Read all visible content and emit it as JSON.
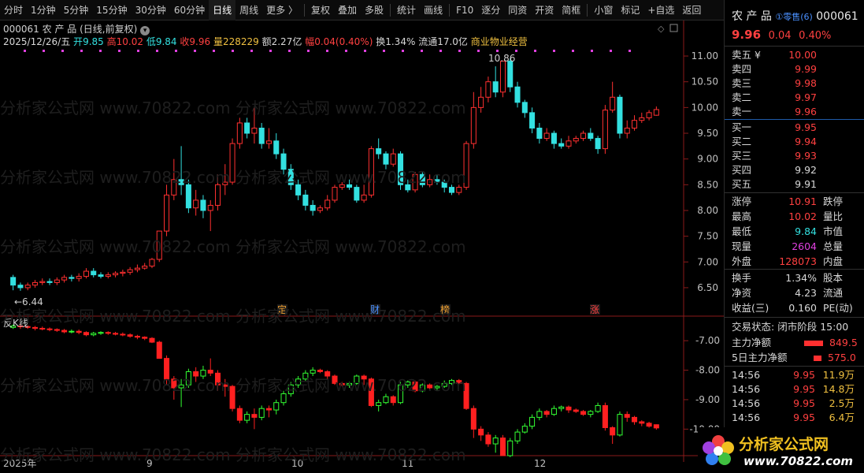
{
  "toolbar": {
    "items": [
      "分时",
      "1分钟",
      "5分钟",
      "15分钟",
      "30分钟",
      "60分钟",
      "日线",
      "周线",
      "更多 〉",
      "复权",
      "叠加",
      "多股",
      "统计",
      "画线",
      "F10",
      "逐分",
      "同资",
      "开资",
      "简框",
      "小窗",
      "标记",
      "+自选",
      "返回"
    ],
    "active": "日线"
  },
  "stock": {
    "code": "000061",
    "name": "农 产 品",
    "mode": "(日线,前复权)",
    "date": "2025/12/26/五",
    "open_label": "开",
    "open": "9.85",
    "high_label": "高",
    "high": "10.02",
    "low_label": "低",
    "low": "9.84",
    "close_label": "收",
    "close": "9.96",
    "vol_label": "量",
    "vol": "228229",
    "amt_label": "额",
    "amt": "2.27亿",
    "amp_label": "幅",
    "amp": "0.04(0.40%)",
    "turn_label": "换",
    "turn": "1.34%",
    "float_label": "流通",
    "float": "17.0亿",
    "sector": "商业物业经营",
    "price_max": "10.86",
    "price_min": "6.44"
  },
  "indicator": {
    "name": "反K线"
  },
  "markers": [
    {
      "text": "定",
      "color": "#f0a030"
    },
    {
      "text": "财",
      "color": "#4a90ff"
    },
    {
      "text": "榜",
      "color": "#f0a030"
    },
    {
      "text": "涨",
      "color": "#ff4040"
    }
  ],
  "chart_data": {
    "type": "candlestick",
    "yticks": [
      "11.00",
      "10.50",
      "10.00",
      "9.50",
      "9.00",
      "8.50",
      "8.00",
      "7.50",
      "7.00",
      "6.50"
    ],
    "ylim": [
      6.3,
      11.2
    ],
    "xlabels": [
      "2025年",
      "9",
      "10",
      "11",
      "12"
    ],
    "indicator_yticks": [
      "-7.00",
      "-8.00",
      "-9.00",
      "-10.00"
    ],
    "indicator_ylim": [
      -10.9,
      -6.3
    ],
    "candles": [
      [
        6.7,
        6.55,
        6.75,
        6.45
      ],
      [
        6.55,
        6.5,
        6.6,
        6.44
      ],
      [
        6.5,
        6.55,
        6.6,
        6.45
      ],
      [
        6.55,
        6.6,
        6.65,
        6.5
      ],
      [
        6.6,
        6.62,
        6.68,
        6.55
      ],
      [
        6.62,
        6.6,
        6.68,
        6.55
      ],
      [
        6.6,
        6.65,
        6.7,
        6.55
      ],
      [
        6.65,
        6.7,
        6.75,
        6.6
      ],
      [
        6.7,
        6.68,
        6.75,
        6.62
      ],
      [
        6.68,
        6.72,
        6.78,
        6.62
      ],
      [
        6.72,
        6.82,
        6.88,
        6.68
      ],
      [
        6.82,
        6.75,
        6.88,
        6.7
      ],
      [
        6.75,
        6.72,
        6.8,
        6.68
      ],
      [
        6.72,
        6.75,
        6.8,
        6.68
      ],
      [
        6.75,
        6.78,
        6.82,
        6.7
      ],
      [
        6.78,
        6.8,
        6.85,
        6.72
      ],
      [
        6.8,
        6.85,
        6.9,
        6.75
      ],
      [
        6.85,
        6.88,
        6.95,
        6.8
      ],
      [
        6.88,
        6.92,
        6.98,
        6.85
      ],
      [
        6.92,
        7.05,
        7.08,
        6.88
      ],
      [
        7.05,
        7.6,
        7.6,
        7.0
      ],
      [
        7.6,
        8.3,
        8.5,
        7.5
      ],
      [
        8.3,
        8.6,
        9.0,
        8.2
      ],
      [
        8.6,
        8.5,
        9.25,
        8.3
      ],
      [
        8.5,
        8.05,
        8.6,
        7.95
      ],
      [
        8.05,
        8.2,
        8.4,
        7.9
      ],
      [
        8.2,
        8.0,
        8.3,
        7.85
      ],
      [
        8.0,
        8.1,
        8.2,
        7.6
      ],
      [
        8.1,
        8.5,
        8.7,
        8.0
      ],
      [
        8.5,
        8.55,
        8.9,
        8.3
      ],
      [
        8.55,
        9.3,
        9.4,
        8.5
      ],
      [
        9.3,
        9.7,
        9.8,
        9.2
      ],
      [
        9.7,
        9.5,
        9.8,
        9.4
      ],
      [
        9.5,
        9.6,
        10.0,
        9.3
      ],
      [
        9.6,
        9.3,
        9.7,
        9.2
      ],
      [
        9.3,
        9.35,
        9.6,
        9.2
      ],
      [
        9.35,
        9.1,
        9.5,
        9.0
      ],
      [
        9.1,
        8.8,
        9.2,
        8.7
      ],
      [
        8.8,
        8.5,
        8.9,
        8.4
      ],
      [
        8.5,
        8.3,
        8.6,
        8.2
      ],
      [
        8.3,
        8.1,
        8.4,
        8.0
      ],
      [
        8.1,
        8.0,
        8.2,
        7.9
      ],
      [
        8.0,
        8.05,
        8.1,
        7.95
      ],
      [
        8.05,
        8.2,
        8.3,
        8.0
      ],
      [
        8.2,
        8.45,
        8.5,
        8.15
      ],
      [
        8.45,
        8.5,
        8.55,
        8.4
      ],
      [
        8.5,
        8.45,
        8.6,
        8.4
      ],
      [
        8.45,
        8.2,
        8.5,
        8.15
      ],
      [
        8.2,
        8.3,
        8.5,
        8.15
      ],
      [
        8.3,
        9.2,
        9.25,
        8.25
      ],
      [
        9.2,
        9.1,
        9.4,
        9.0
      ],
      [
        9.1,
        8.9,
        9.15,
        8.8
      ],
      [
        8.9,
        9.1,
        9.2,
        8.85
      ],
      [
        9.1,
        8.5,
        9.15,
        8.4
      ],
      [
        8.5,
        8.4,
        8.6,
        8.35
      ],
      [
        8.4,
        8.7,
        8.75,
        8.35
      ],
      [
        8.7,
        8.5,
        8.75,
        8.45
      ],
      [
        8.5,
        8.6,
        8.7,
        8.45
      ],
      [
        8.6,
        8.55,
        8.7,
        8.5
      ],
      [
        8.55,
        8.45,
        8.6,
        8.35
      ],
      [
        8.45,
        8.35,
        8.5,
        8.3
      ],
      [
        8.35,
        8.45,
        8.5,
        8.3
      ],
      [
        8.45,
        9.3,
        9.35,
        8.4
      ],
      [
        9.3,
        10.0,
        10.3,
        9.2
      ],
      [
        10.0,
        10.2,
        10.4,
        9.9
      ],
      [
        10.2,
        10.5,
        10.6,
        10.1
      ],
      [
        10.5,
        10.3,
        10.8,
        10.2
      ],
      [
        10.3,
        10.9,
        10.9,
        10.2
      ],
      [
        10.9,
        10.4,
        10.95,
        10.3
      ],
      [
        10.4,
        10.1,
        10.5,
        10.0
      ],
      [
        10.1,
        9.9,
        10.15,
        9.8
      ],
      [
        9.9,
        9.6,
        10.0,
        9.5
      ],
      [
        9.6,
        9.4,
        9.7,
        9.3
      ],
      [
        9.4,
        9.5,
        9.6,
        9.35
      ],
      [
        9.5,
        9.3,
        9.55,
        9.2
      ],
      [
        9.3,
        9.25,
        9.4,
        9.2
      ],
      [
        9.25,
        9.35,
        9.45,
        9.2
      ],
      [
        9.35,
        9.4,
        9.45,
        9.3
      ],
      [
        9.4,
        9.5,
        9.55,
        9.35
      ],
      [
        9.5,
        9.4,
        9.6,
        9.35
      ],
      [
        9.4,
        9.2,
        9.45,
        9.1
      ],
      [
        9.2,
        9.95,
        10.05,
        9.1
      ],
      [
        9.95,
        10.2,
        10.5,
        9.9
      ],
      [
        10.2,
        9.5,
        10.25,
        9.4
      ],
      [
        9.5,
        9.6,
        9.75,
        9.4
      ],
      [
        9.6,
        9.75,
        9.85,
        9.55
      ],
      [
        9.75,
        9.8,
        9.9,
        9.7
      ],
      [
        9.8,
        9.9,
        9.95,
        9.75
      ],
      [
        9.85,
        9.96,
        10.02,
        9.84
      ]
    ],
    "ind": [
      [
        -6.55,
        -6.5,
        -6.45,
        -6.6
      ],
      [
        -6.5,
        -6.52,
        -6.45,
        -6.6
      ],
      [
        -6.52,
        -6.55,
        -6.48,
        -6.6
      ],
      [
        -6.55,
        -6.58,
        -6.5,
        -6.65
      ],
      [
        -6.58,
        -6.6,
        -6.52,
        -6.65
      ],
      [
        -6.6,
        -6.62,
        -6.55,
        -6.68
      ],
      [
        -6.62,
        -6.65,
        -6.58,
        -6.7
      ],
      [
        -6.65,
        -6.7,
        -6.6,
        -6.75
      ],
      [
        -6.7,
        -6.68,
        -6.62,
        -6.75
      ],
      [
        -6.68,
        -6.72,
        -6.62,
        -6.78
      ],
      [
        -6.72,
        -6.8,
        -6.68,
        -6.85
      ],
      [
        -6.8,
        -6.75,
        -6.7,
        -6.85
      ],
      [
        -6.75,
        -6.72,
        -6.68,
        -6.8
      ],
      [
        -6.72,
        -6.75,
        -6.68,
        -6.8
      ],
      [
        -6.75,
        -6.78,
        -6.7,
        -6.82
      ],
      [
        -6.78,
        -6.8,
        -6.72,
        -6.85
      ],
      [
        -6.8,
        -6.85,
        -6.75,
        -6.9
      ],
      [
        -6.85,
        -6.88,
        -6.8,
        -6.95
      ],
      [
        -6.88,
        -6.92,
        -6.85,
        -6.98
      ],
      [
        -6.92,
        -7.05,
        -6.88,
        -7.08
      ],
      [
        -7.05,
        -7.6,
        -7.0,
        -7.6
      ],
      [
        -7.6,
        -8.3,
        -7.5,
        -8.5
      ],
      [
        -8.3,
        -8.6,
        -8.2,
        -9.0
      ],
      [
        -8.6,
        -8.5,
        -8.3,
        -9.25
      ],
      [
        -8.5,
        -8.05,
        -7.95,
        -8.6
      ],
      [
        -8.05,
        -8.2,
        -7.9,
        -8.4
      ],
      [
        -8.2,
        -8.0,
        -7.85,
        -8.3
      ],
      [
        -8.0,
        -8.1,
        -7.6,
        -8.2
      ],
      [
        -8.1,
        -8.5,
        -8.0,
        -8.7
      ],
      [
        -8.5,
        -8.55,
        -8.3,
        -8.9
      ],
      [
        -8.55,
        -9.3,
        -8.5,
        -9.4
      ],
      [
        -9.3,
        -9.7,
        -9.2,
        -9.8
      ],
      [
        -9.7,
        -9.5,
        -9.4,
        -9.8
      ],
      [
        -9.5,
        -9.6,
        -9.3,
        -10.0
      ],
      [
        -9.6,
        -9.3,
        -9.2,
        -9.7
      ],
      [
        -9.3,
        -9.35,
        -9.2,
        -9.6
      ],
      [
        -9.35,
        -9.1,
        -9.0,
        -9.5
      ],
      [
        -9.1,
        -8.8,
        -8.7,
        -9.2
      ],
      [
        -8.8,
        -8.5,
        -8.4,
        -8.9
      ],
      [
        -8.5,
        -8.3,
        -8.2,
        -8.6
      ],
      [
        -8.3,
        -8.1,
        -8.0,
        -8.4
      ],
      [
        -8.1,
        -8.0,
        -7.9,
        -8.2
      ],
      [
        -8.0,
        -8.05,
        -7.95,
        -8.1
      ],
      [
        -8.05,
        -8.2,
        -8.0,
        -8.3
      ],
      [
        -8.2,
        -8.45,
        -8.15,
        -8.5
      ],
      [
        -8.45,
        -8.5,
        -8.4,
        -8.55
      ],
      [
        -8.5,
        -8.45,
        -8.4,
        -8.6
      ],
      [
        -8.45,
        -8.2,
        -8.15,
        -8.5
      ],
      [
        -8.2,
        -8.3,
        -8.15,
        -8.5
      ],
      [
        -8.3,
        -9.2,
        -8.25,
        -9.25
      ],
      [
        -9.2,
        -9.1,
        -9.0,
        -9.4
      ],
      [
        -9.1,
        -8.9,
        -8.8,
        -9.15
      ],
      [
        -8.9,
        -9.1,
        -8.85,
        -9.2
      ],
      [
        -9.1,
        -8.5,
        -8.4,
        -9.15
      ],
      [
        -8.5,
        -8.4,
        -8.35,
        -8.6
      ],
      [
        -8.4,
        -8.7,
        -8.35,
        -8.75
      ],
      [
        -8.7,
        -8.5,
        -8.45,
        -8.75
      ],
      [
        -8.5,
        -8.6,
        -8.45,
        -8.7
      ],
      [
        -8.6,
        -8.55,
        -8.5,
        -8.7
      ],
      [
        -8.55,
        -8.45,
        -8.35,
        -8.6
      ],
      [
        -8.45,
        -8.35,
        -8.3,
        -8.5
      ],
      [
        -8.35,
        -8.45,
        -8.3,
        -8.5
      ],
      [
        -8.45,
        -9.3,
        -8.4,
        -9.35
      ],
      [
        -9.3,
        -10.0,
        -9.2,
        -10.3
      ],
      [
        -10.0,
        -10.2,
        -9.9,
        -10.4
      ],
      [
        -10.2,
        -10.5,
        -10.1,
        -10.6
      ],
      [
        -10.5,
        -10.3,
        -10.2,
        -10.8
      ],
      [
        -10.3,
        -10.9,
        -10.2,
        -10.9
      ],
      [
        -10.9,
        -10.4,
        -10.3,
        -10.95
      ],
      [
        -10.4,
        -10.1,
        -10.0,
        -10.5
      ],
      [
        -10.1,
        -9.9,
        -9.8,
        -10.15
      ],
      [
        -9.9,
        -9.6,
        -9.5,
        -10.0
      ],
      [
        -9.6,
        -9.4,
        -9.3,
        -9.7
      ],
      [
        -9.4,
        -9.5,
        -9.35,
        -9.6
      ],
      [
        -9.5,
        -9.3,
        -9.2,
        -9.55
      ],
      [
        -9.3,
        -9.25,
        -9.2,
        -9.4
      ],
      [
        -9.25,
        -9.35,
        -9.2,
        -9.45
      ],
      [
        -9.35,
        -9.4,
        -9.3,
        -9.45
      ],
      [
        -9.4,
        -9.5,
        -9.35,
        -9.55
      ],
      [
        -9.5,
        -9.4,
        -9.35,
        -9.6
      ],
      [
        -9.4,
        -9.2,
        -9.1,
        -9.45
      ],
      [
        -9.2,
        -9.95,
        -9.1,
        -10.05
      ],
      [
        -9.95,
        -10.2,
        -9.9,
        -10.5
      ],
      [
        -10.2,
        -9.5,
        -9.4,
        -10.25
      ],
      [
        -9.5,
        -9.6,
        -9.4,
        -9.75
      ],
      [
        -9.6,
        -9.75,
        -9.55,
        -9.85
      ],
      [
        -9.75,
        -9.8,
        -9.7,
        -9.9
      ],
      [
        -9.8,
        -9.9,
        -9.75,
        -9.95
      ],
      [
        -9.85,
        -9.96,
        -9.84,
        -10.02
      ]
    ]
  },
  "quote": {
    "price": "9.96",
    "change": "0.04",
    "pct": "0.40%",
    "badge": "①零售(6)"
  },
  "book": {
    "asks": [
      {
        "label": "卖五 ¥",
        "price": "10.00"
      },
      {
        "label": "卖四",
        "price": "9.99"
      },
      {
        "label": "卖三",
        "price": "9.98"
      },
      {
        "label": "卖二",
        "price": "9.97"
      },
      {
        "label": "卖一",
        "price": "9.96"
      }
    ],
    "bids": [
      {
        "label": "买一",
        "price": "9.95"
      },
      {
        "label": "买二",
        "price": "9.94"
      },
      {
        "label": "买三",
        "price": "9.93"
      },
      {
        "label": "买四",
        "price": "9.92"
      },
      {
        "label": "买五",
        "price": "9.91"
      }
    ]
  },
  "stats": [
    {
      "l1": "涨停",
      "v1": "10.91",
      "c1": "#ff4040",
      "l2": "跌停"
    },
    {
      "l1": "最高",
      "v1": "10.02",
      "c1": "#ff4040",
      "l2": "量比"
    },
    {
      "l1": "最低",
      "v1": "9.84",
      "c1": "#33e0e0",
      "l2": "市值"
    },
    {
      "l1": "现量",
      "v1": "2604",
      "c1": "#e040e0",
      "l2": "总量"
    },
    {
      "l1": "外盘",
      "v1": "128073",
      "c1": "#ff4040",
      "l2": "内盘"
    }
  ],
  "stats2": [
    {
      "l1": "换手",
      "v1": "1.34%",
      "l2": "股本"
    },
    {
      "l1": "净资",
      "v1": "4.23",
      "l2": "流通"
    },
    {
      "l1": "收益(三)",
      "v1": "0.160",
      "l2": "PE(动)"
    }
  ],
  "status": {
    "label": "交易状态:",
    "value": "闭市阶段",
    "time": "15:00"
  },
  "flows": [
    {
      "label": "主力净额",
      "value": "849.5"
    },
    {
      "label": "5日主力净额",
      "value": "575.0"
    }
  ],
  "ticks": [
    {
      "time": "14:56",
      "price": "9.95",
      "vol": "11.9万"
    },
    {
      "time": "14:56",
      "price": "9.95",
      "vol": "14.8万"
    },
    {
      "time": "14:56",
      "price": "9.95",
      "vol": "2.5万"
    },
    {
      "time": "14:56",
      "price": "9.95",
      "vol": "6.4万"
    }
  ],
  "watermark": "分析家公式网 www.70822.com",
  "logo": {
    "name": "分析家公式网",
    "url": "www.70822.com"
  },
  "colors": {
    "up": "#ff3030",
    "down": "#33e0e0",
    "ind_up": "#33ff33",
    "ind_down": "#ff2020",
    "accent": "#1e5aa8"
  }
}
